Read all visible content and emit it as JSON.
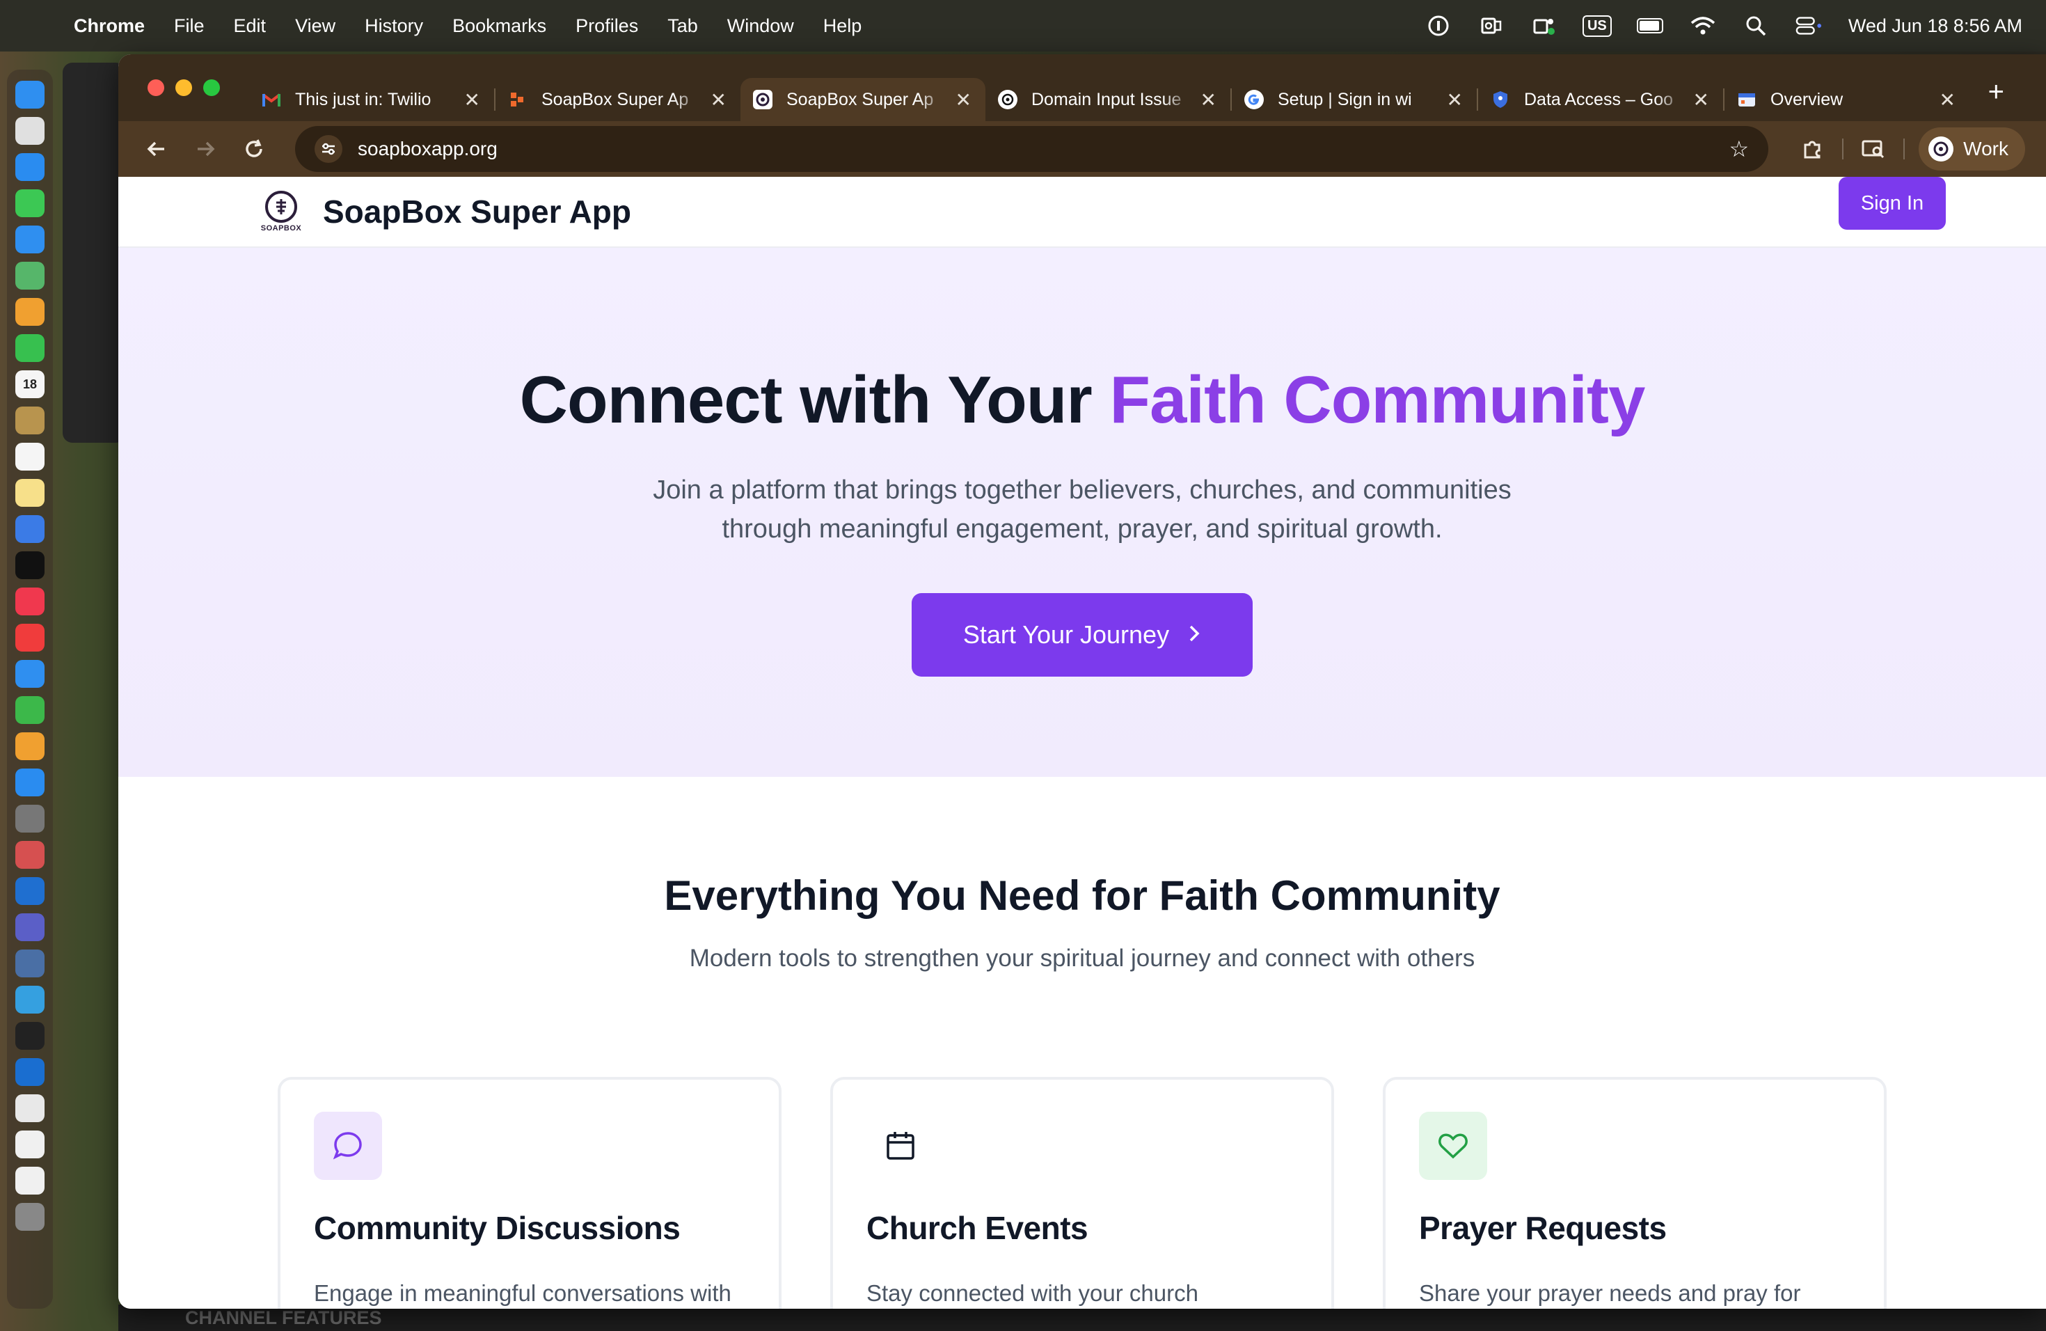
{
  "menubar": {
    "app_name": "Chrome",
    "items": [
      "File",
      "Edit",
      "View",
      "History",
      "Bookmarks",
      "Profiles",
      "Tab",
      "Window",
      "Help"
    ],
    "keyboard_layout": "US",
    "clock": "Wed Jun 18  8:56 AM"
  },
  "dock": {
    "calendar_day": "18"
  },
  "browser": {
    "tabs": [
      {
        "title": "This just in: Twilio",
        "icon": "gmail-icon",
        "active": false
      },
      {
        "title": "SoapBox Super Ap",
        "icon": "soapbox-icon",
        "active": false
      },
      {
        "title": "SoapBox Super Ap",
        "icon": "soapbox-logo-icon",
        "active": true
      },
      {
        "title": "Domain Input Issue",
        "icon": "chatgpt-icon",
        "active": false
      },
      {
        "title": "Setup  |  Sign in wi",
        "icon": "google-icon",
        "active": false
      },
      {
        "title": "Data Access – Goo",
        "icon": "shield-icon",
        "active": false
      },
      {
        "title": "Overview",
        "icon": "dashboard-icon",
        "active": false
      }
    ],
    "url": "soapboxapp.org",
    "profile_name": "Work"
  },
  "site": {
    "header": {
      "logo_text": "SOAPBOX",
      "brand": "SoapBox Super App",
      "sign_in": "Sign In"
    },
    "hero": {
      "title_start": "Connect with Your ",
      "title_accent": "Faith Community",
      "subtitle_line1": "Join a platform that brings together believers, churches, and communities",
      "subtitle_line2": "through meaningful engagement, prayer, and spiritual growth.",
      "cta": "Start Your Journey"
    },
    "features": {
      "title": "Everything You Need for Faith Community",
      "subtitle": "Modern tools to strengthen your spiritual journey and connect with others",
      "cards": [
        {
          "title": "Community Discussions",
          "text": "Engage in meaningful conversations with",
          "icon": "chat-bubble-icon"
        },
        {
          "title": "Church Events",
          "text": "Stay connected with your church",
          "icon": "calendar-icon"
        },
        {
          "title": "Prayer Requests",
          "text": "Share your prayer needs and pray for",
          "icon": "heart-icon"
        }
      ]
    }
  },
  "background": {
    "bottom_label": "CHANNEL FEATURES"
  },
  "colors": {
    "accent": "#7c3aed",
    "accent_text": "#8b3fe6",
    "hero_bg": "#f3efff"
  }
}
